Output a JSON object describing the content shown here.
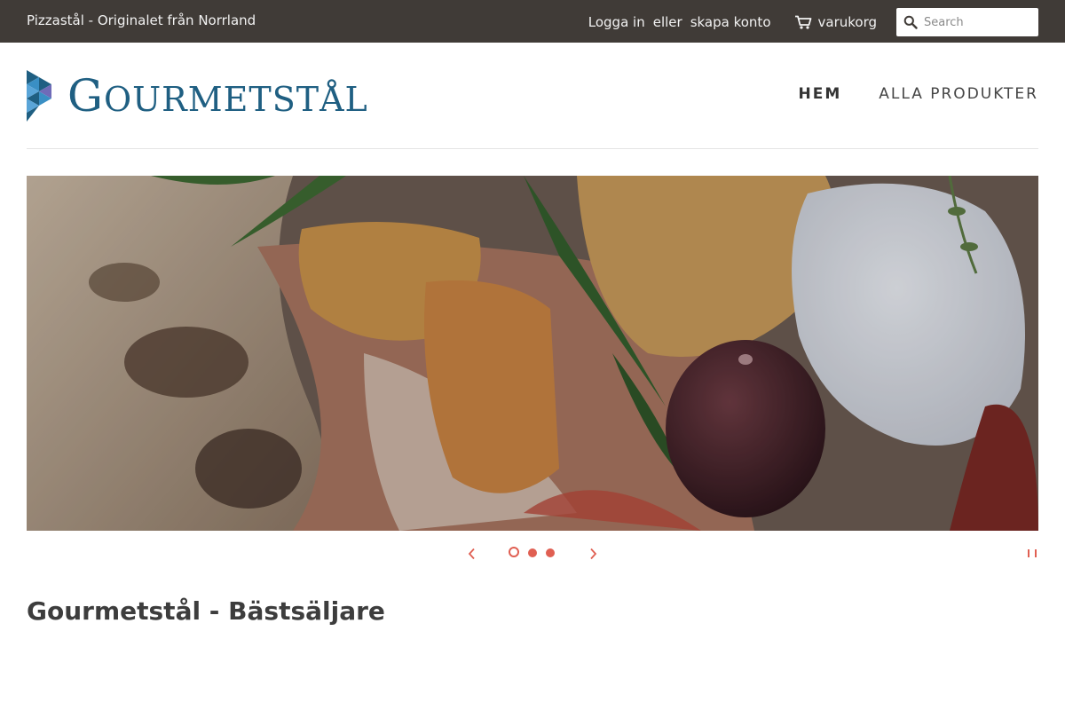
{
  "topbar": {
    "announcement": "Pizzastål - Originalet från Norrland",
    "login_label": "Logga in",
    "separator": "eller",
    "register_label": "skapa konto",
    "cart_label": "varukorg",
    "cart_icon": "cart-icon",
    "search_icon": "search-icon",
    "search_placeholder": "Search",
    "search_value": ""
  },
  "header": {
    "logo_text_cap": "G",
    "logo_text_rest": "OURMETSTÅL",
    "nav": {
      "home": "HEM",
      "all_products": "ALLA PRODUKTER"
    }
  },
  "slideshow": {
    "current_slide": 1,
    "slide_count": 3,
    "prev_icon": "chevron-left-icon",
    "next_icon": "chevron-right-icon",
    "pause_icon": "pause-icon"
  },
  "main": {
    "section_title": "Gourmetstål - Bästsäljare"
  },
  "colors": {
    "topbar_bg": "#403b37",
    "brand_blue": "#1f5f82",
    "accent": "#e05f52"
  }
}
